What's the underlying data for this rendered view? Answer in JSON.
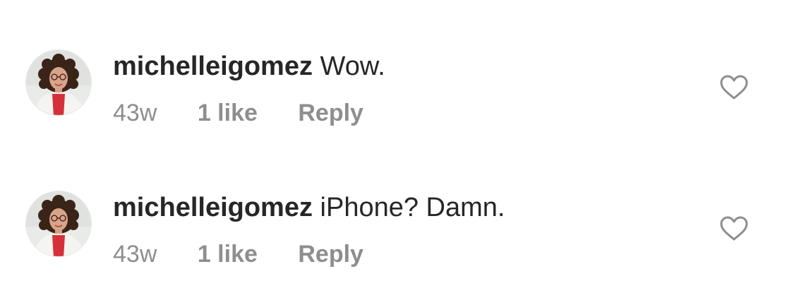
{
  "comments": [
    {
      "username": "michelleigomez",
      "text": "Wow.",
      "time": "43w",
      "likes": "1 like",
      "reply_label": "Reply",
      "avatar_icon": "profile-photo-avatar",
      "like_icon": "heart-outline-icon"
    },
    {
      "username": "michelleigomez",
      "text": "iPhone? Damn.",
      "time": "43w",
      "likes": "1 like",
      "reply_label": "Reply",
      "avatar_icon": "profile-photo-avatar",
      "like_icon": "heart-outline-icon"
    }
  ],
  "colors": {
    "text_primary": "#262626",
    "text_secondary": "#8e8e8e",
    "background": "#ffffff"
  }
}
